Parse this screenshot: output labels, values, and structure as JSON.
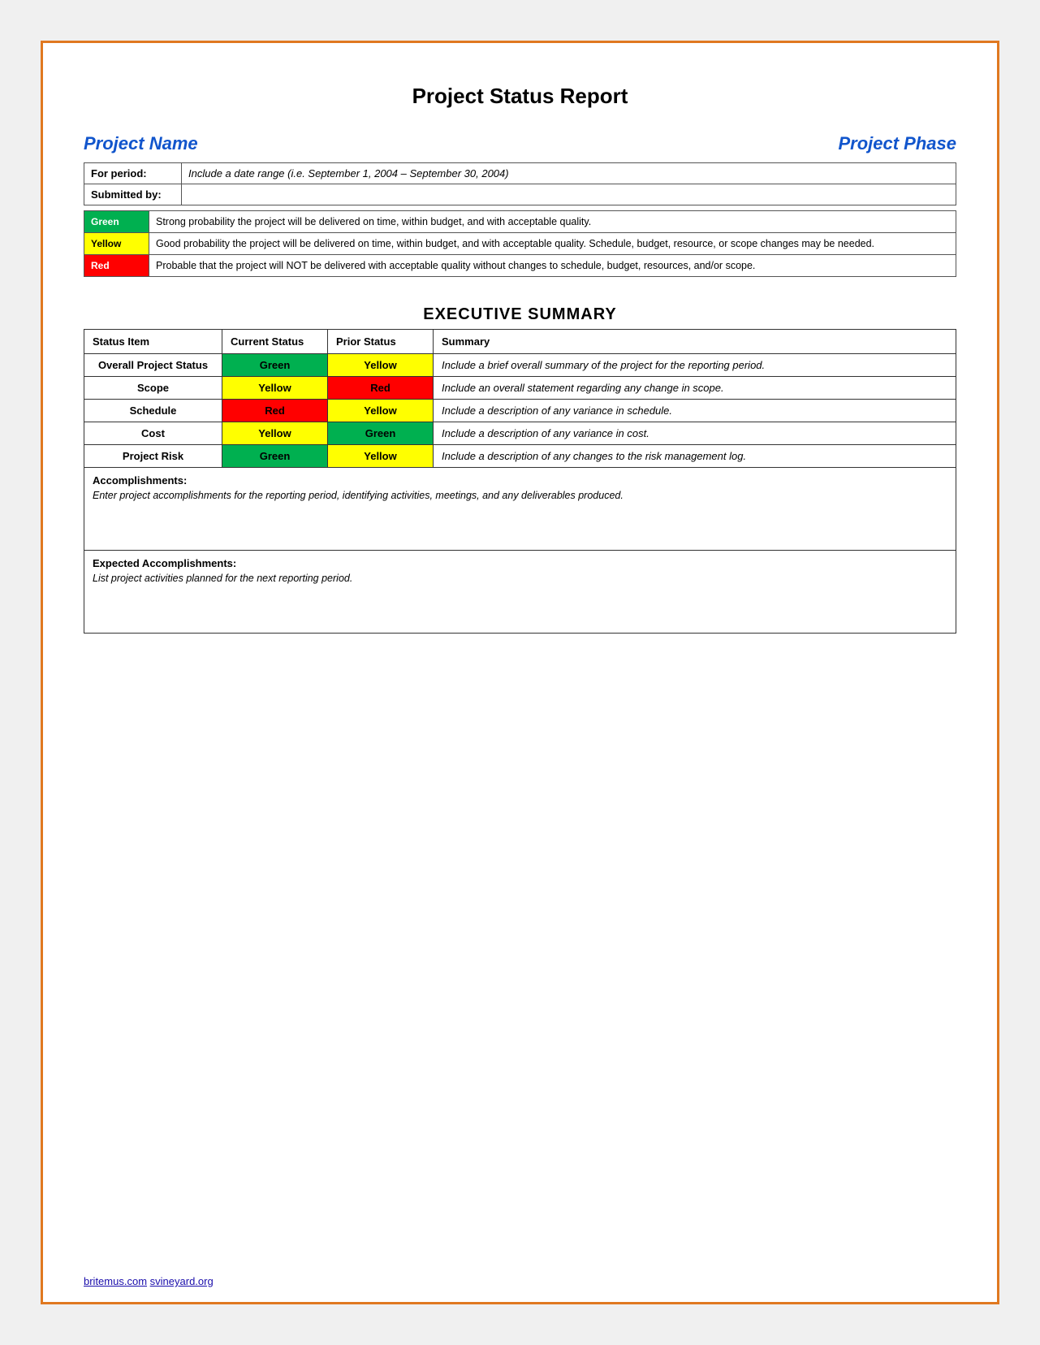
{
  "page": {
    "title": "Project Status Report",
    "project_name_label": "Project Name",
    "project_phase_label": "Project Phase",
    "for_period_label": "For period:",
    "for_period_value": "Include a date range (i.e. September 1, 2004 – September 30, 2004)",
    "submitted_by_label": "Submitted by:",
    "submitted_by_value": "",
    "legend": [
      {
        "status": "Green",
        "color_class": "status-green",
        "description": "Strong probability the project will be delivered on time, within budget, and with acceptable quality."
      },
      {
        "status": "Yellow",
        "color_class": "status-yellow",
        "description": "Good probability the project will be delivered on time, within budget, and with acceptable quality. Schedule, budget, resource, or scope changes may be needed."
      },
      {
        "status": "Red",
        "color_class": "status-red",
        "description": "Probable that the project will NOT be delivered with acceptable quality without changes to schedule, budget, resources, and/or scope."
      }
    ],
    "exec_summary_title": "EXECUTIVE SUMMARY",
    "exec_table_headers": [
      "Status Item",
      "Current Status",
      "Prior Status",
      "Summary"
    ],
    "exec_rows": [
      {
        "item": "Overall Project Status",
        "current": "Green",
        "current_class": "cell-green",
        "prior": "Yellow",
        "prior_class": "cell-yellow",
        "summary": "Include a brief overall summary of the project for the reporting period."
      },
      {
        "item": "Scope",
        "current": "Yellow",
        "current_class": "cell-yellow",
        "prior": "Red",
        "prior_class": "cell-red",
        "summary": "Include an overall statement regarding any change in scope."
      },
      {
        "item": "Schedule",
        "current": "Red",
        "current_class": "cell-red",
        "prior": "Yellow",
        "prior_class": "cell-yellow",
        "summary": "Include a description of any variance in schedule."
      },
      {
        "item": "Cost",
        "current": "Yellow",
        "current_class": "cell-yellow",
        "prior": "Green",
        "prior_class": "cell-green",
        "summary": "Include a description of any variance in cost."
      },
      {
        "item": "Project Risk",
        "current": "Green",
        "current_class": "cell-green",
        "prior": "Yellow",
        "prior_class": "cell-yellow",
        "summary": "Include a description of any changes to the risk management log."
      }
    ],
    "accomplishments_title": "Accomplishments:",
    "accomplishments_text": "Enter project accomplishments for the reporting period, identifying activities, meetings, and any deliverables produced.",
    "expected_title": "Expected Accomplishments:",
    "expected_text": "List project activities planned for the next reporting period.",
    "footer_text": "britemus.com",
    "footer_text2": "svineyard.org"
  }
}
